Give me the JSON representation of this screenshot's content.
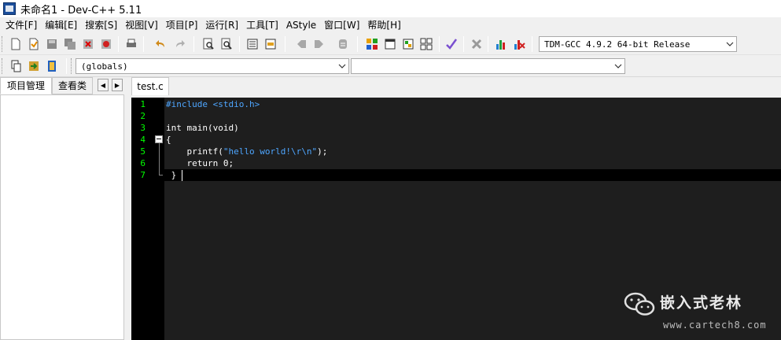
{
  "window": {
    "title": "未命名1 - Dev-C++ 5.11"
  },
  "menu": [
    "文件[F]",
    "编辑[E]",
    "搜索[S]",
    "视图[V]",
    "项目[P]",
    "运行[R]",
    "工具[T]",
    "AStyle",
    "窗口[W]",
    "帮助[H]"
  ],
  "toolbar": {
    "compiler_select": "TDM-GCC 4.9.2 64-bit Release",
    "icons": [
      "new-file-icon",
      "open-file-icon",
      "save-icon",
      "save-all-icon",
      "close-file-icon",
      "print-icon",
      "undo-icon",
      "redo-icon",
      "find-icon",
      "replace-icon",
      "indent-icon",
      "unindent-icon",
      "toggle-bookmark-icon",
      "goto-bookmark-icon",
      "comment-icon",
      "compile-icon",
      "run-icon",
      "compile-run-icon",
      "rebuild-icon",
      "syntax-check-icon",
      "stop-icon",
      "profile-icon",
      "delete-profile-icon"
    ]
  },
  "toolbar2": {
    "class_select": "(globals)",
    "member_select": "",
    "icons": [
      "new-class-icon",
      "insert-icon",
      "goto-icon"
    ]
  },
  "left_panel": {
    "tabs": [
      "项目管理",
      "查看类"
    ],
    "active_tab": "项目管理"
  },
  "editor": {
    "tab_label": "test.c",
    "line_numbers": [
      "1",
      "2",
      "3",
      "4",
      "5",
      "6",
      "7"
    ],
    "lines": [
      {
        "segments": [
          {
            "text": "#include <stdio.h>",
            "cls": "t-pre"
          }
        ]
      },
      {
        "segments": []
      },
      {
        "segments": [
          {
            "text": "int main(void)",
            "cls": ""
          }
        ]
      },
      {
        "segments": [
          {
            "text": "{",
            "cls": ""
          }
        ]
      },
      {
        "segments": [
          {
            "text": "    printf(",
            "cls": ""
          },
          {
            "text": "\"hello world!\\r\\n\"",
            "cls": "t-str"
          },
          {
            "text": ");",
            "cls": ""
          }
        ]
      },
      {
        "segments": [
          {
            "text": "    return ",
            "cls": ""
          },
          {
            "text": "0",
            "cls": "t-num"
          },
          {
            "text": ";",
            "cls": ""
          }
        ]
      },
      {
        "segments": [
          {
            "text": " }",
            "cls": ""
          }
        ]
      }
    ]
  },
  "watermark": {
    "title": "嵌入式老林",
    "url": "www.cartech8.com"
  }
}
